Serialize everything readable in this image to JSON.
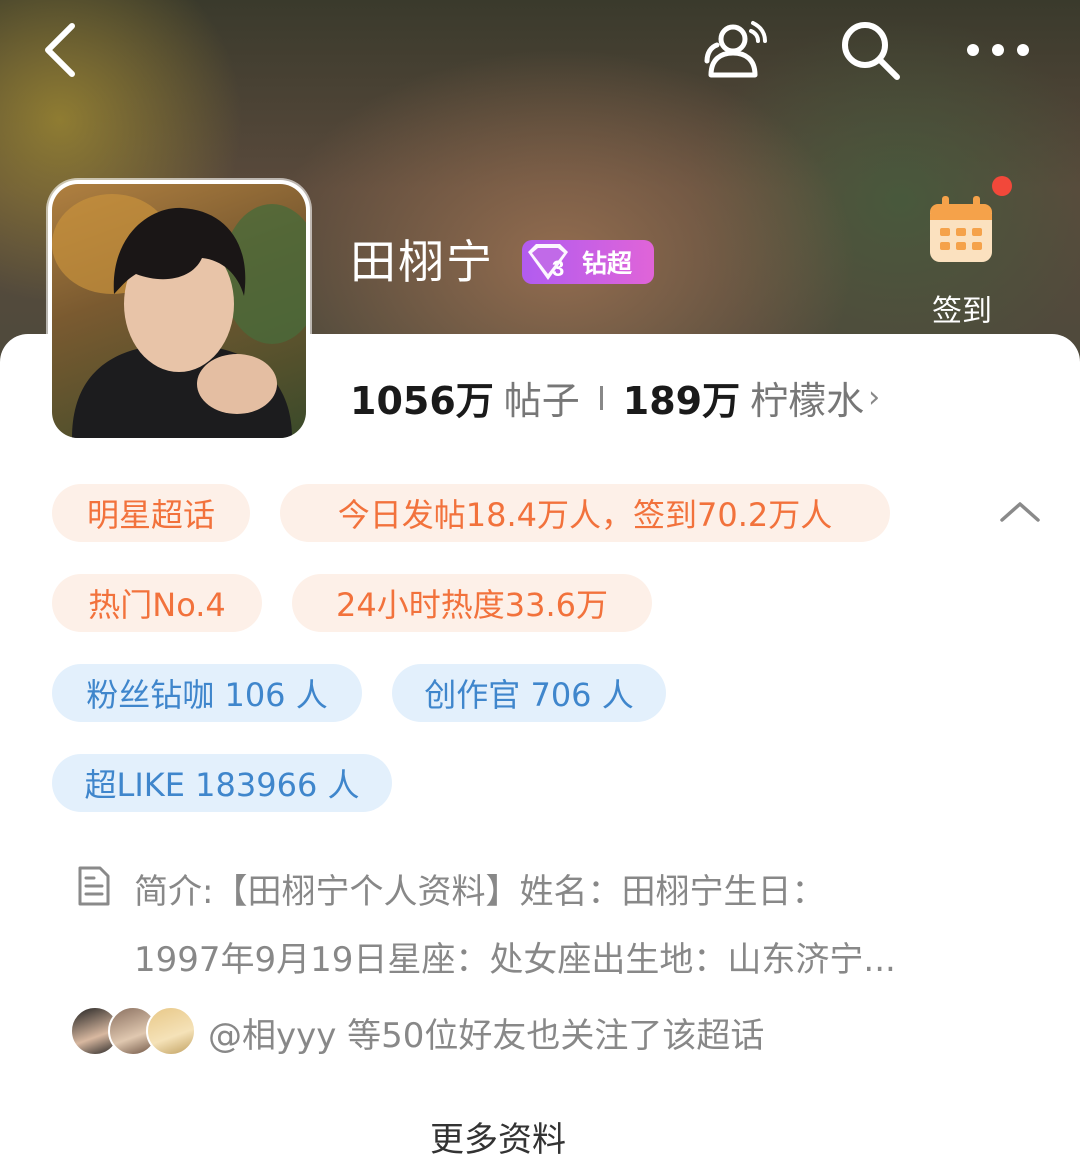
{
  "header": {
    "back_icon": "chevron-left-icon",
    "group_icon": "group-icon",
    "search_icon": "search-icon",
    "more_icon": "more-icon"
  },
  "topic": {
    "name": "田栩宁",
    "badge_label": "钻超",
    "badge_level": "3"
  },
  "checkin": {
    "label": "签到",
    "has_notification": true
  },
  "stats": {
    "posts_count": "1056万",
    "posts_label": "帖子",
    "lemon_count": "189万",
    "lemon_label": "柠檬水"
  },
  "tags": {
    "category": "明星超话",
    "today": "今日发帖18.4万人，签到70.2万人",
    "rank": "热门No.4",
    "heat": "24小时热度33.6万",
    "fans": "粉丝钻咖 106 人",
    "creators": "创作官 706 人",
    "super_like": "超LIKE 183966 人"
  },
  "intro": {
    "line1": "简介:【田栩宁个人资料】姓名：田栩宁生日：",
    "line2": "1997年9月19日星座：处女座出生地：山东济宁..."
  },
  "friends": {
    "text": "@相yyy 等50位好友也关注了该超话"
  },
  "more_info": {
    "label": "更多资料"
  },
  "colors": {
    "orange_tag_bg": "#fdf0e8",
    "orange_tag_text": "#f2723c",
    "blue_tag_bg": "#e3f0fc",
    "blue_tag_text": "#3f86cc",
    "badge_gradient_start": "#b15cf0",
    "badge_gradient_end": "#e064d8",
    "notification_dot": "#f2483a"
  }
}
